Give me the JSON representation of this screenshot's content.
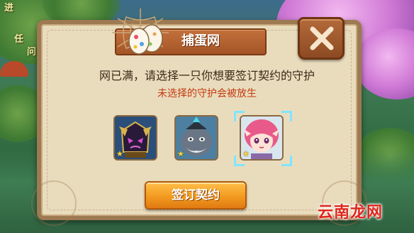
{
  "background": {
    "top_left_text_1": "进",
    "top_left_text_2": "任",
    "top_left_text_3": "问"
  },
  "dialog": {
    "title": "捕蛋网",
    "message": "网已满，请选择一只你想要签订契约的守护",
    "warning": "未选择的守护会被放生",
    "confirm_label": "签订契约",
    "close_label": "X"
  },
  "guardians": [
    {
      "name": "dark-armor-guardian",
      "stars": "★",
      "selected": false
    },
    {
      "name": "grey-yeti-guardian",
      "stars": "★",
      "selected": false
    },
    {
      "name": "pink-hair-girl-guardian",
      "stars": "★",
      "selected": true
    }
  ],
  "watermark": "云南龙网",
  "colors": {
    "dialog_bg": "#e9dcbd",
    "title_ribbon": "#b35f2f",
    "warning_text": "#c43a12",
    "confirm_button": "#f29a1f",
    "selection_highlight": "#7fe6ff"
  }
}
